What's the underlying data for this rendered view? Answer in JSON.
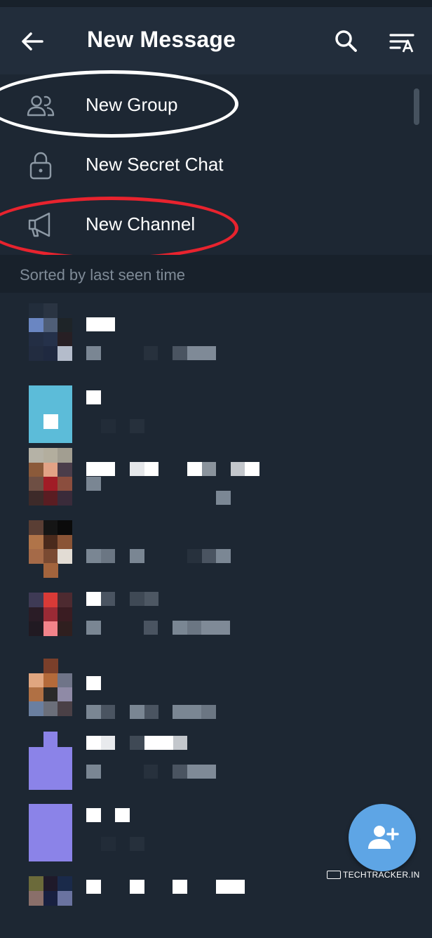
{
  "header": {
    "title": "New Message",
    "back_icon": "arrow-left-icon",
    "search_icon": "search-icon",
    "sort_icon": "sort-by-name-icon",
    "background": "#222d3b"
  },
  "menu": {
    "items": [
      {
        "label": "New Group",
        "icon": "group-icon",
        "annotation": "white-ellipse"
      },
      {
        "label": "New Secret Chat",
        "icon": "lock-icon"
      },
      {
        "label": "New Channel",
        "icon": "megaphone-icon",
        "annotation": "red-ellipse"
      }
    ]
  },
  "section": {
    "label": "Sorted by last seen time"
  },
  "contacts": {
    "note_pixelated": true,
    "count_visible": 9
  },
  "fab": {
    "icon": "add-contact-icon",
    "color": "#5ea5e5"
  },
  "watermark": {
    "text": "TECHTRACKER.IN"
  },
  "colors": {
    "background": "#1d2733",
    "section_background": "#18212b",
    "section_text": "#7f8b97",
    "annotation_white": "#ffffff",
    "annotation_red": "#e8232e"
  }
}
